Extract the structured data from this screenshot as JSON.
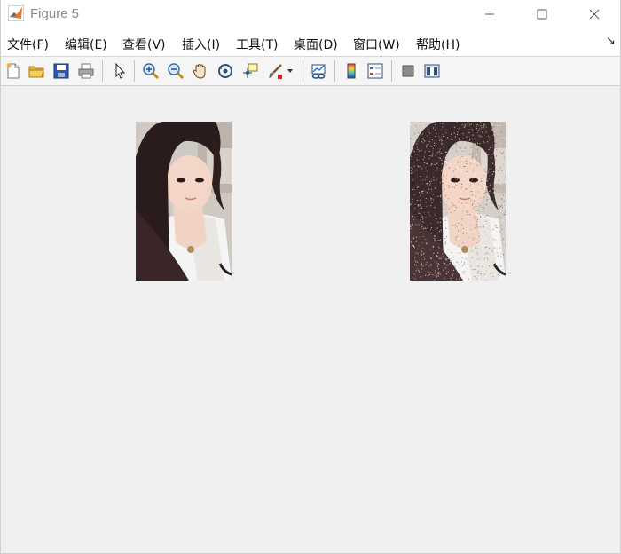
{
  "window": {
    "title": "Figure 5",
    "minimize_glyph": "—",
    "maximize_glyph": "☐",
    "close_glyph": "✕"
  },
  "menu": {
    "items": [
      {
        "label": "文件(F)"
      },
      {
        "label": "编辑(E)"
      },
      {
        "label": "查看(V)"
      },
      {
        "label": "插入(I)"
      },
      {
        "label": "工具(T)"
      },
      {
        "label": "桌面(D)"
      },
      {
        "label": "窗口(W)"
      },
      {
        "label": "帮助(H)"
      }
    ],
    "dock_glyph": "↘"
  },
  "toolbar": {
    "buttons": [
      {
        "icon": "new-figure-icon"
      },
      {
        "icon": "open-file-icon"
      },
      {
        "icon": "save-icon"
      },
      {
        "icon": "print-icon"
      },
      {
        "icon": "pointer-icon"
      },
      {
        "icon": "zoom-in-icon"
      },
      {
        "icon": "zoom-out-icon"
      },
      {
        "icon": "pan-icon"
      },
      {
        "icon": "rotate-3d-icon"
      },
      {
        "icon": "data-cursor-icon"
      },
      {
        "icon": "brush-icon"
      },
      {
        "icon": "link-plot-icon"
      },
      {
        "icon": "colorbar-icon"
      },
      {
        "icon": "legend-icon"
      },
      {
        "icon": "hide-plot-tools-icon"
      },
      {
        "icon": "show-plot-tools-icon"
      }
    ]
  },
  "figure": {
    "images": [
      {
        "name": "original-photo",
        "noise": false
      },
      {
        "name": "noisy-photo",
        "noise": true
      }
    ],
    "colors": {
      "background": "#f0f0f0",
      "hair": "#2a1c1c",
      "skin": "#f2d2c4",
      "shirt": "#f4f4f4"
    }
  }
}
